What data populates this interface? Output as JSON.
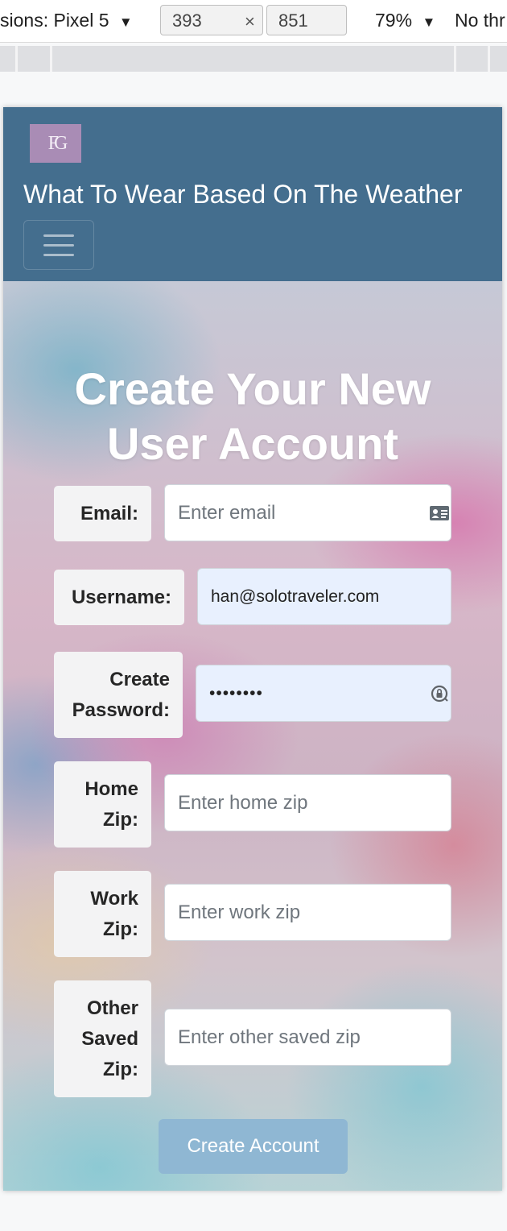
{
  "devtools": {
    "device_label": "sions: Pixel 5",
    "width_value": "393",
    "height_value": "851",
    "times_symbol": "×",
    "zoom_label": "79%",
    "throttle_label": "No thr"
  },
  "navbar": {
    "logo_text": "FG",
    "title": "What To Wear Based On The Weather"
  },
  "page": {
    "title_line1": "Create Your New",
    "title_line2": "User Account"
  },
  "form": {
    "email": {
      "label": "Email:",
      "placeholder": "Enter email",
      "value": ""
    },
    "username": {
      "label": "Username:",
      "value": "han@solotraveler.com"
    },
    "password": {
      "label_line1": "Create",
      "label_line2": "Password:",
      "value": "••••••••"
    },
    "home_zip": {
      "label_line1": "Home",
      "label_line2": "Zip:",
      "placeholder": "Enter home zip"
    },
    "work_zip": {
      "label_line1": "Work",
      "label_line2": "Zip:",
      "placeholder": "Enter work zip"
    },
    "other_zip": {
      "label_line1": "Other",
      "label_line2": "Saved",
      "label_line3": "Zip:",
      "placeholder": "Enter other saved zip"
    },
    "submit_label": "Create Account"
  },
  "colors": {
    "navbar_bg": "#446e8e",
    "logo_bg": "#a98cb5",
    "button_bg": "#8fb7d3",
    "autofill_bg": "#e8f0fe"
  },
  "icons": {
    "email_field": "contact-card-icon",
    "password_field": "password-key-icon",
    "dropdown": "caret-down-icon",
    "menu": "hamburger-icon"
  }
}
